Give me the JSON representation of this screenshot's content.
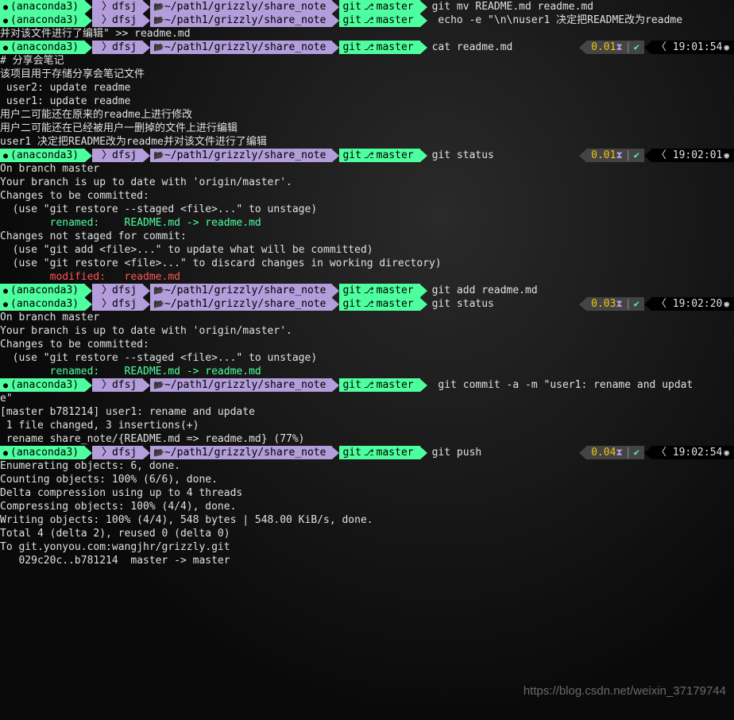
{
  "env": "(anaconda3)",
  "user": "dfsj",
  "path": "~/path1/grizzly/share_note",
  "git_label": "git",
  "branch": "master",
  "commands": {
    "c1": "git mv README.md readme.md",
    "c2": "echo -e \"\\n\\nuser1 决定把README改为readme并对该文件进行了编辑\" >> readme.md",
    "c2_wrap": "并对该文件进行了编辑\" >> readme.md",
    "c3": "cat readme.md",
    "c4": "git status",
    "c5": "git add readme.md",
    "c6": "git status",
    "c7": "git commit -a -m \"user1: rename and update\"",
    "c7_wrap": "e\"",
    "c8": "git push"
  },
  "status": {
    "t1": {
      "dur": "0.01",
      "time": "19:01:54"
    },
    "t2": {
      "dur": "0.01",
      "time": "19:02:01"
    },
    "t3": {
      "dur": "0.03",
      "time": "19:02:20"
    },
    "t4": {
      "dur": "0.04",
      "time": "19:02:54"
    }
  },
  "cat_output": {
    "l1": "# 分享会笔记",
    "l2": "",
    "l3": "该项目用于存储分享会笔记文件",
    "l4": "",
    "l5": " user2: update readme",
    "l6": " user1: update readme",
    "l7": "",
    "l8": "用户二可能还在原来的readme上进行修改",
    "l9": "",
    "l10": "用户二可能还在已经被用户一删掉的文件上进行编辑",
    "l11": "",
    "l12": "",
    "l13": "user1 决定把README改为readme并对该文件进行了编辑"
  },
  "status1": {
    "l1": "On branch master",
    "l2": "Your branch is up to date with 'origin/master'.",
    "l3": "",
    "l4": "Changes to be committed:",
    "l5": "  (use \"git restore --staged <file>...\" to unstage)",
    "l6": "        renamed:    README.md -> readme.md",
    "l7": "",
    "l8": "Changes not staged for commit:",
    "l9": "  (use \"git add <file>...\" to update what will be committed)",
    "l10": "  (use \"git restore <file>...\" to discard changes in working directory)",
    "l11": "        modified:   readme.md",
    "l12": ""
  },
  "status2": {
    "l1": "On branch master",
    "l2": "Your branch is up to date with 'origin/master'.",
    "l3": "",
    "l4": "Changes to be committed:",
    "l5": "  (use \"git restore --staged <file>...\" to unstage)",
    "l6": "        renamed:    README.md -> readme.md",
    "l7": ""
  },
  "commit_out": {
    "l1": "[master b781214] user1: rename and update",
    "l2": " 1 file changed, 3 insertions(+)",
    "l3": " rename share_note/{README.md => readme.md} (77%)"
  },
  "push_out": {
    "l1": "Enumerating objects: 6, done.",
    "l2": "Counting objects: 100% (6/6), done.",
    "l3": "Delta compression using up to 4 threads",
    "l4": "Compressing objects: 100% (4/4), done.",
    "l5": "Writing objects: 100% (4/4), 548 bytes | 548.00 KiB/s, done.",
    "l6": "Total 4 (delta 2), reused 0 (delta 0)",
    "l7": "To git.yonyou.com:wangjhr/grizzly.git",
    "l8": "   029c20c..b781214  master -> master"
  },
  "watermark": "https://blog.csdn.net/weixin_37179744"
}
